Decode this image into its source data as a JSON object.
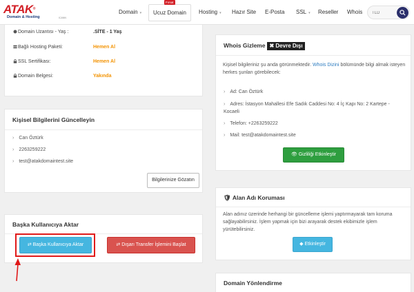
{
  "nav": {
    "logo": "ATAK",
    "logo_sub": "Domain & Hosting",
    "logo_icann": "ICANN",
    "items": [
      {
        "label": "Domain",
        "caret": true
      },
      {
        "label": "Ucuz Domain",
        "caret": false,
        "badge": "Fırsat"
      },
      {
        "label": "Hosting",
        "caret": true
      },
      {
        "label": "Hazır Site",
        "caret": false
      },
      {
        "label": "E-Posta",
        "caret": false
      },
      {
        "label": "SSL",
        "caret": true
      },
      {
        "label": "Reseller",
        "caret": false
      },
      {
        "label": "Whois",
        "caret": false
      }
    ],
    "search_placeholder": "TLD"
  },
  "domain_info": {
    "rows": [
      {
        "icon": "calendar-icon",
        "label": "Domain Uzantısı - Yaş :",
        "value": ".SİTE - 1 Yaş",
        "value_color": "#333333"
      },
      {
        "icon": "server-icon",
        "label": "Bağlı Hosting Paketi:",
        "value": "Hemen Al",
        "value_color": "#f39200"
      },
      {
        "icon": "lock-icon",
        "label": "SSL Sertifikası:",
        "value": "Hemen Al",
        "value_color": "#f39200"
      },
      {
        "icon": "lock-icon",
        "label": "Domain Belgesi:",
        "value": "Yakında",
        "value_color": "#f39200"
      }
    ]
  },
  "personal_update": {
    "title": "Kişisel Bilgilerini Güncelleyin",
    "items": [
      "Can Öztürk",
      "2263259222",
      "test@atakdomaintest.site"
    ],
    "button": "Bilgilerinize Gözatın"
  },
  "transfer": {
    "title": "Başka Kullanıcıya Aktar",
    "btn_user": "Başka Kullanıcıya Aktar",
    "btn_out": "Dışarı Transfer İşlemini Başlat"
  },
  "whois_privacy": {
    "title": "Whois Gizleme",
    "status": "Devre Dışı",
    "desc_pre": "Kişisel bilgileriniz şu anda görünmektedir.",
    "desc_link": "Whois Dizini",
    "desc_post": "bölümünde bilgi almak isteyen herkes şunları görebilecek:",
    "items": [
      "Ad: Can Öztürk",
      "Adres: İstasyon Mahallesi Efe Sadık Caddesi No: 4 İç Kapı No: 2 Kartepe - Kocaeli",
      "Telefon: +2263259222",
      "Mail: test@atakdomaintest.site"
    ],
    "button": "Gizliliği Etkinleştir"
  },
  "domain_protection": {
    "title": "Alan Adı Koruması",
    "desc": "Alan adınız üzerinde herhangi bir güncelleme işlemi yaptırmayarak tam koruma sağlayabilirsiniz. İşlem yapmak için bizi arayarak destek ekibimizle işlem yürütebilirsiniz.",
    "button": "Etkinleştir"
  },
  "redirect": {
    "title": "Domain Yönlendirme"
  },
  "colors": {
    "brand_red": "#d21f26",
    "orange": "#f39200",
    "info": "#45b6e0",
    "danger": "#d9534f",
    "success": "#2e9e3f",
    "annotation_red": "#e01919"
  }
}
